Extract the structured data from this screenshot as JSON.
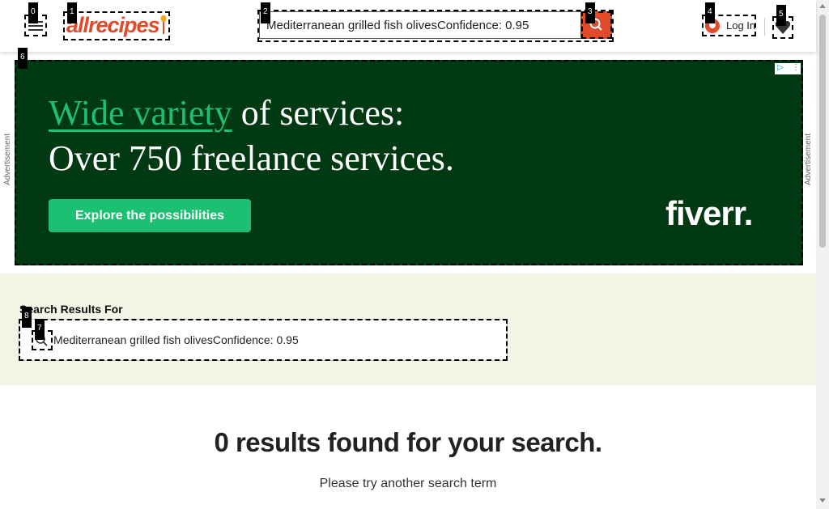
{
  "header": {
    "logo_text": "allrecipes",
    "search_value": "Mediterranean grilled fish olivesConfidence: 0.95",
    "login_label": "Log In"
  },
  "ad": {
    "label": "Advertisement",
    "headline_accent": "Wide variety",
    "headline_rest": " of services:",
    "headline_line2": "Over 750 freelance services.",
    "button_label": "Explore the possibilities",
    "brand": "fiverr."
  },
  "results": {
    "label": "Search Results For",
    "query": "Mediterranean grilled fish olivesConfidence: 0.95",
    "zero_heading": "0 results found for your search.",
    "try_text": "Please try another search term"
  },
  "markers": [
    "0",
    "1",
    "2",
    "3",
    "4",
    "5",
    "6",
    "7",
    "8"
  ],
  "colors": {
    "brand": "#e04b2a",
    "ad_bg": "#003912",
    "ad_accent": "#1dbf73",
    "results_band": "#f3f3e6"
  }
}
